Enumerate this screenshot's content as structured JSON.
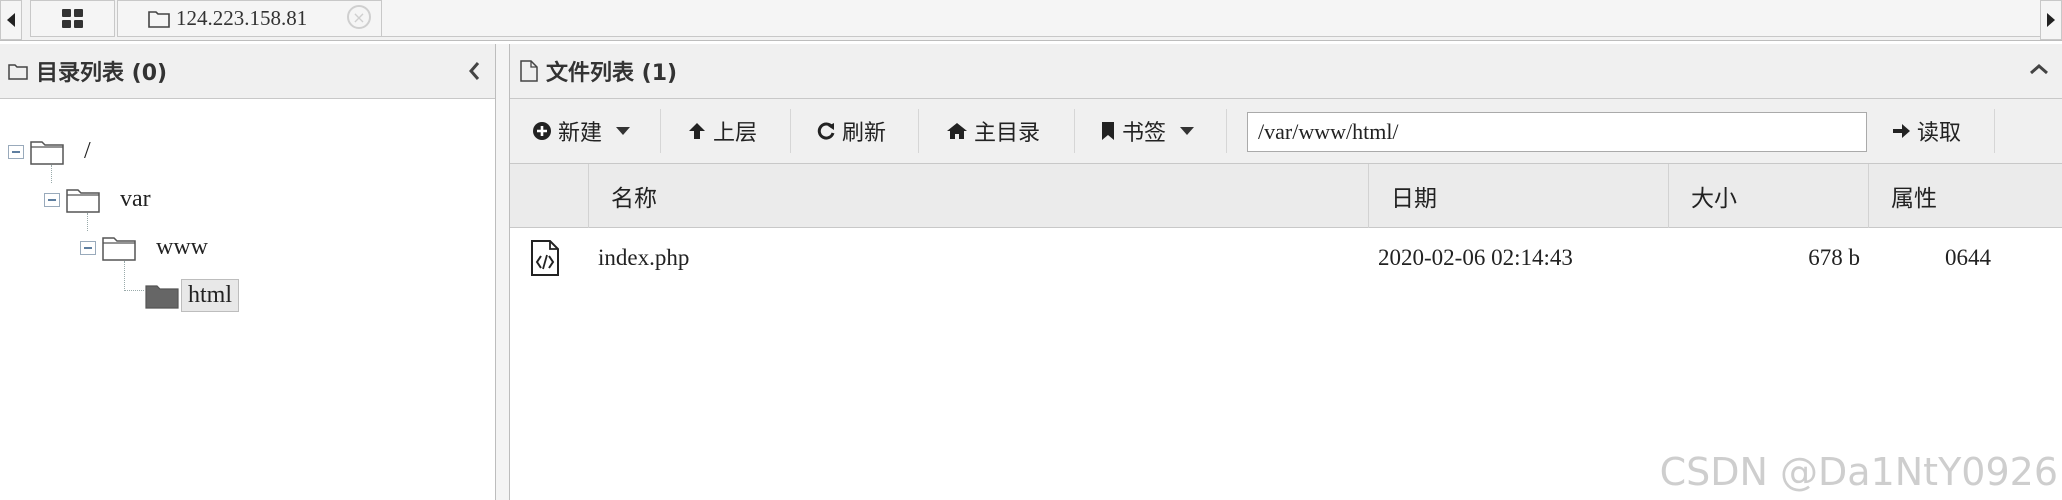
{
  "tabs": {
    "home_icon": "grid-icon",
    "server_tab": {
      "icon": "folder-icon",
      "label": "124.223.158.81"
    }
  },
  "left_panel": {
    "title": "目录列表 (0)",
    "tree": [
      {
        "label": "/"
      },
      {
        "label": "var"
      },
      {
        "label": "www"
      },
      {
        "label": "html"
      }
    ]
  },
  "right_panel": {
    "title": "文件列表 (1)",
    "toolbar": {
      "new_label": "新建",
      "up_label": "上层",
      "refresh_label": "刷新",
      "home_label": "主目录",
      "bookmark_label": "书签",
      "path_value": "/var/www/html/",
      "read_label": "读取"
    },
    "columns": [
      "名称",
      "日期",
      "大小",
      "属性"
    ],
    "files": [
      {
        "name": "index.php",
        "date": "2020-02-06 02:14:43",
        "size": "678 b",
        "perm": "0644"
      }
    ]
  },
  "watermark": "CSDN @Da1NtY0926"
}
